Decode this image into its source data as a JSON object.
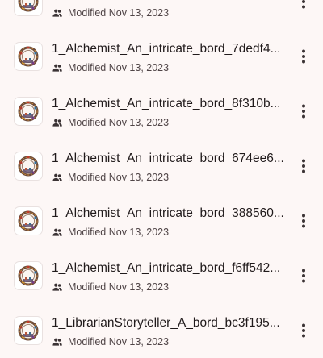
{
  "files": [
    {
      "name": "",
      "modified": "Modified Nov 13, 2023",
      "thumb_icon": "ornate-circular-border-image-icon",
      "shared_icon": "shared-people-icon",
      "more_icon": "more-vert-icon"
    },
    {
      "name": "1_Alchemist_An_intricate_bord_7dedf4...",
      "modified": "Modified Nov 13, 2023",
      "thumb_icon": "ornate-circular-border-image-icon",
      "shared_icon": "shared-people-icon",
      "more_icon": "more-vert-icon"
    },
    {
      "name": "1_Alchemist_An_intricate_bord_8f310b...",
      "modified": "Modified Nov 13, 2023",
      "thumb_icon": "ornate-circular-border-image-icon",
      "shared_icon": "shared-people-icon",
      "more_icon": "more-vert-icon"
    },
    {
      "name": "1_Alchemist_An_intricate_bord_674ee6...",
      "modified": "Modified Nov 13, 2023",
      "thumb_icon": "ornate-circular-border-image-icon",
      "shared_icon": "shared-people-icon",
      "more_icon": "more-vert-icon"
    },
    {
      "name": "1_Alchemist_An_intricate_bord_388560...",
      "modified": "Modified Nov 13, 2023",
      "thumb_icon": "ornate-circular-border-image-icon",
      "shared_icon": "shared-people-icon",
      "more_icon": "more-vert-icon"
    },
    {
      "name": "1_Alchemist_An_intricate_bord_f6ff542...",
      "modified": "Modified Nov 13, 2023",
      "thumb_icon": "ornate-circular-border-image-icon",
      "shared_icon": "shared-people-icon",
      "more_icon": "more-vert-icon"
    },
    {
      "name": "1_LibrarianStoryteller_A_bord_bc3f195...",
      "modified": "Modified Nov 13, 2023",
      "thumb_icon": "ornate-circular-border-image-icon",
      "shared_icon": "shared-people-icon",
      "more_icon": "more-vert-icon"
    }
  ],
  "colors": {
    "background": "#fdf7f6",
    "title_text": "#201a1b",
    "meta_text": "#4f4446",
    "icon": "#3b3335"
  }
}
